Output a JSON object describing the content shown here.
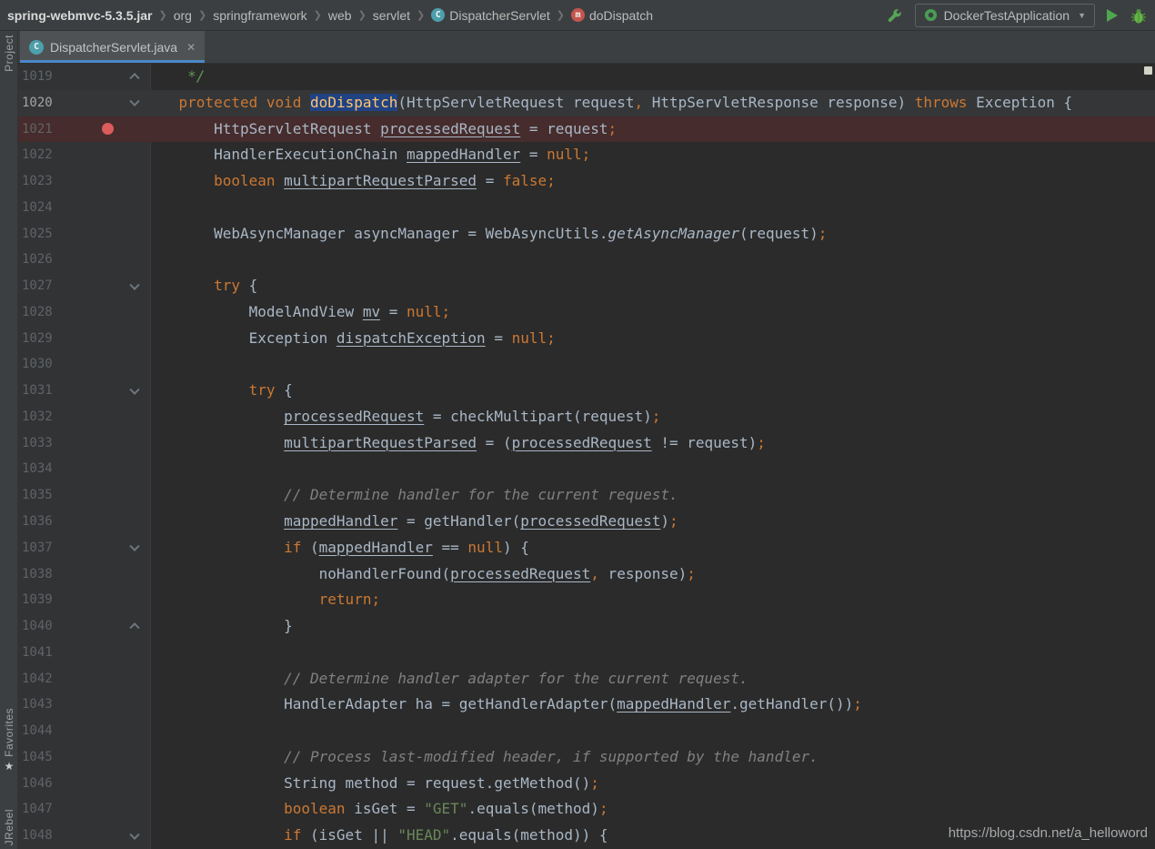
{
  "breadcrumbs": {
    "items": [
      {
        "label": "spring-webmvc-5.3.5.jar",
        "bold": true
      },
      {
        "label": "org"
      },
      {
        "label": "springframework"
      },
      {
        "label": "web"
      },
      {
        "label": "servlet"
      },
      {
        "label": "DispatcherServlet",
        "icon": "class"
      },
      {
        "label": "doDispatch",
        "icon": "method"
      }
    ]
  },
  "toolbar": {
    "run_config_label": "DockerTestApplication"
  },
  "tabs": [
    {
      "label": "DispatcherServlet.java",
      "active": true
    }
  ],
  "tool_windows": {
    "project": "Project",
    "favorites": "Favorites",
    "jrebel": "JRebel"
  },
  "watermark": "https://blog.csdn.net/a_helloword",
  "colors": {
    "editor_background": "#2B2B2B",
    "toolbar_background": "#3C3F41",
    "accent_blue": "#4A88C7",
    "selection_blue": "#214283",
    "caret_line": "#343638",
    "breakpoint_line": "#462C2C",
    "breakpoint_red": "#DB5C5C",
    "keyword_orange": "#CC7832",
    "string_green": "#6A8759",
    "comment_gray": "#808080",
    "method_yellow": "#FFC66D",
    "plain_text": "#A9B7C6",
    "line_number_gray": "#606366",
    "run_green": "#4EA64E"
  },
  "editor": {
    "lines": [
      {
        "num": 1019,
        "fold": "up",
        "tokens": [
          [
            "doc",
            "\t */"
          ]
        ]
      },
      {
        "num": 1020,
        "fold": "down",
        "bg": "caret",
        "tokens": [
          [
            "pl",
            "\t"
          ],
          [
            "kw",
            "protected"
          ],
          [
            "pl",
            " "
          ],
          [
            "kw",
            "void"
          ],
          [
            "pl",
            " "
          ],
          [
            "mth sel",
            "doDispatch"
          ],
          [
            "pl",
            "(HttpServletRequest request"
          ],
          [
            "kw",
            ","
          ],
          [
            "pl",
            " HttpServletResponse response) "
          ],
          [
            "kw",
            "throws"
          ],
          [
            "pl",
            " Exception {"
          ]
        ]
      },
      {
        "num": 1021,
        "bg": "bp",
        "breakpoint": true,
        "tokens": [
          [
            "pl",
            "\t\tHttpServletRequest "
          ],
          [
            "var",
            "processedRequest"
          ],
          [
            "pl",
            " = request"
          ],
          [
            "kw",
            ";"
          ]
        ]
      },
      {
        "num": 1022,
        "tokens": [
          [
            "pl",
            "\t\tHandlerExecutionChain "
          ],
          [
            "var",
            "mappedHandler"
          ],
          [
            "pl",
            " = "
          ],
          [
            "kw",
            "null;"
          ]
        ]
      },
      {
        "num": 1023,
        "tokens": [
          [
            "pl",
            "\t\t"
          ],
          [
            "kw",
            "boolean"
          ],
          [
            "pl",
            " "
          ],
          [
            "var",
            "multipartRequestParsed"
          ],
          [
            "pl",
            " = "
          ],
          [
            "kw",
            "false;"
          ]
        ]
      },
      {
        "num": 1024,
        "tokens": []
      },
      {
        "num": 1025,
        "tokens": [
          [
            "pl",
            "\t\tWebAsyncManager asyncManager = WebAsyncUtils."
          ],
          [
            "it",
            "getAsyncManager"
          ],
          [
            "pl",
            "(request)"
          ],
          [
            "kw",
            ";"
          ]
        ]
      },
      {
        "num": 1026,
        "tokens": []
      },
      {
        "num": 1027,
        "fold": "down",
        "tokens": [
          [
            "pl",
            "\t\t"
          ],
          [
            "kw",
            "try"
          ],
          [
            "pl",
            " {"
          ]
        ]
      },
      {
        "num": 1028,
        "tokens": [
          [
            "pl",
            "\t\t\tModelAndView "
          ],
          [
            "var",
            "mv"
          ],
          [
            "pl",
            " = "
          ],
          [
            "kw",
            "null;"
          ]
        ]
      },
      {
        "num": 1029,
        "tokens": [
          [
            "pl",
            "\t\t\tException "
          ],
          [
            "var",
            "dispatchException"
          ],
          [
            "pl",
            " = "
          ],
          [
            "kw",
            "null;"
          ]
        ]
      },
      {
        "num": 1030,
        "tokens": []
      },
      {
        "num": 1031,
        "fold": "down",
        "tokens": [
          [
            "pl",
            "\t\t\t"
          ],
          [
            "kw",
            "try"
          ],
          [
            "pl",
            " {"
          ]
        ]
      },
      {
        "num": 1032,
        "tokens": [
          [
            "pl",
            "\t\t\t\t"
          ],
          [
            "var",
            "processedRequest"
          ],
          [
            "pl",
            " = checkMultipart(request)"
          ],
          [
            "kw",
            ";"
          ]
        ]
      },
      {
        "num": 1033,
        "tokens": [
          [
            "pl",
            "\t\t\t\t"
          ],
          [
            "var",
            "multipartRequestParsed"
          ],
          [
            "pl",
            " = ("
          ],
          [
            "var",
            "processedRequest"
          ],
          [
            "pl",
            " != request)"
          ],
          [
            "kw",
            ";"
          ]
        ]
      },
      {
        "num": 1034,
        "tokens": []
      },
      {
        "num": 1035,
        "tokens": [
          [
            "pl",
            "\t\t\t\t"
          ],
          [
            "cmt",
            "// Determine handler for the current request."
          ]
        ]
      },
      {
        "num": 1036,
        "tokens": [
          [
            "pl",
            "\t\t\t\t"
          ],
          [
            "var",
            "mappedHandler"
          ],
          [
            "pl",
            " = getHandler("
          ],
          [
            "var",
            "processedRequest"
          ],
          [
            "pl",
            ")"
          ],
          [
            "kw",
            ";"
          ]
        ]
      },
      {
        "num": 1037,
        "fold": "down",
        "tokens": [
          [
            "pl",
            "\t\t\t\t"
          ],
          [
            "kw",
            "if"
          ],
          [
            "pl",
            " ("
          ],
          [
            "var",
            "mappedHandler"
          ],
          [
            "pl",
            " == "
          ],
          [
            "kw",
            "null"
          ],
          [
            "pl",
            ") {"
          ]
        ]
      },
      {
        "num": 1038,
        "tokens": [
          [
            "pl",
            "\t\t\t\t\tnoHandlerFound("
          ],
          [
            "var",
            "processedRequest"
          ],
          [
            "kw",
            ","
          ],
          [
            "pl",
            " response)"
          ],
          [
            "kw",
            ";"
          ]
        ]
      },
      {
        "num": 1039,
        "tokens": [
          [
            "pl",
            "\t\t\t\t\t"
          ],
          [
            "kw",
            "return;"
          ]
        ]
      },
      {
        "num": 1040,
        "fold": "up",
        "tokens": [
          [
            "pl",
            "\t\t\t\t}"
          ]
        ]
      },
      {
        "num": 1041,
        "tokens": []
      },
      {
        "num": 1042,
        "tokens": [
          [
            "pl",
            "\t\t\t\t"
          ],
          [
            "cmt",
            "// Determine handler adapter for the current request."
          ]
        ]
      },
      {
        "num": 1043,
        "tokens": [
          [
            "pl",
            "\t\t\t\tHandlerAdapter ha = getHandlerAdapter("
          ],
          [
            "var",
            "mappedHandler"
          ],
          [
            "pl",
            ".getHandler())"
          ],
          [
            "kw",
            ";"
          ]
        ]
      },
      {
        "num": 1044,
        "tokens": []
      },
      {
        "num": 1045,
        "tokens": [
          [
            "pl",
            "\t\t\t\t"
          ],
          [
            "cmt",
            "// Process last-modified header, if supported by the handler."
          ]
        ]
      },
      {
        "num": 1046,
        "tokens": [
          [
            "pl",
            "\t\t\t\tString method = request.getMethod()"
          ],
          [
            "kw",
            ";"
          ]
        ]
      },
      {
        "num": 1047,
        "tokens": [
          [
            "pl",
            "\t\t\t\t"
          ],
          [
            "kw",
            "boolean"
          ],
          [
            "pl",
            " isGet = "
          ],
          [
            "str",
            "\"GET\""
          ],
          [
            "pl",
            ".equals(method)"
          ],
          [
            "kw",
            ";"
          ]
        ]
      },
      {
        "num": 1048,
        "fold": "down",
        "tokens": [
          [
            "pl",
            "\t\t\t\t"
          ],
          [
            "kw",
            "if"
          ],
          [
            "pl",
            " (isGet || "
          ],
          [
            "str",
            "\"HEAD\""
          ],
          [
            "pl",
            ".equals(method)) {"
          ]
        ]
      }
    ]
  }
}
